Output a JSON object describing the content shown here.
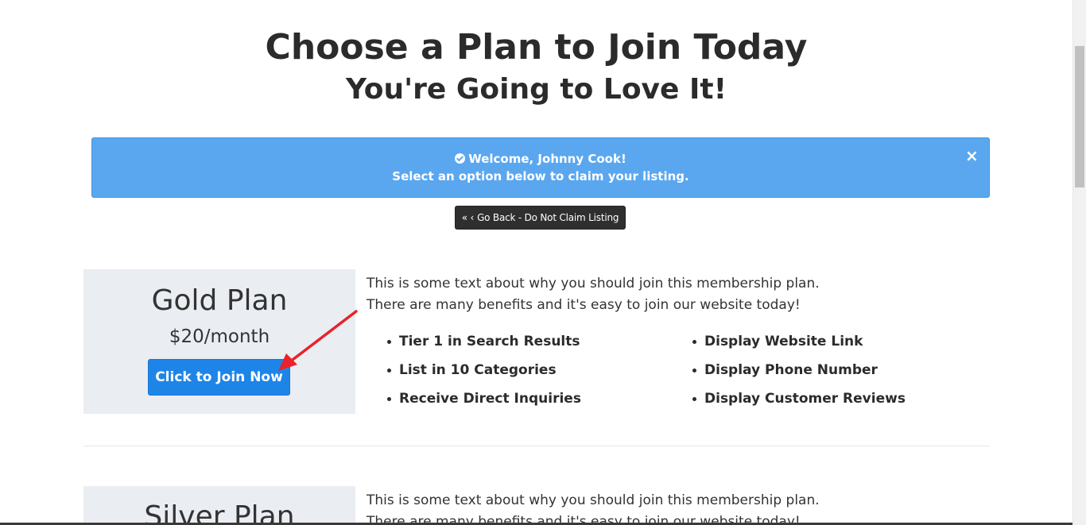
{
  "header": {
    "title": "Choose a Plan to Join Today",
    "subtitle": "You're Going to Love It!"
  },
  "alert": {
    "welcome": "Welcome, Johnny Cook!",
    "message": "Select an option below to claim your listing.",
    "close_label": "×",
    "check_icon": "check-circle-icon",
    "color": "#5aa7f0"
  },
  "go_back": {
    "chevrons": "«  ‹",
    "label": "Go Back - Do Not Claim Listing"
  },
  "plans": [
    {
      "name": "Gold Plan",
      "price": "$20/month",
      "button_label": "Click to Join Now",
      "description": [
        "This is some text about why you should join this membership plan.",
        "There are many benefits and it's easy to join our website today!"
      ],
      "benefits_left": [
        "Tier 1 in Search Results",
        "List in 10 Categories",
        "Receive Direct Inquiries"
      ],
      "benefits_right": [
        "Display Website Link",
        "Display Phone Number",
        "Display Customer Reviews"
      ]
    },
    {
      "name": "Silver Plan",
      "description": [
        "This is some text about why you should join this membership plan.",
        "There are many benefits and it's easy to join our website today!"
      ]
    }
  ],
  "colors": {
    "button": "#1e85e8",
    "plan_box": "#eaedf2",
    "annotation_arrow": "#e8232b"
  }
}
